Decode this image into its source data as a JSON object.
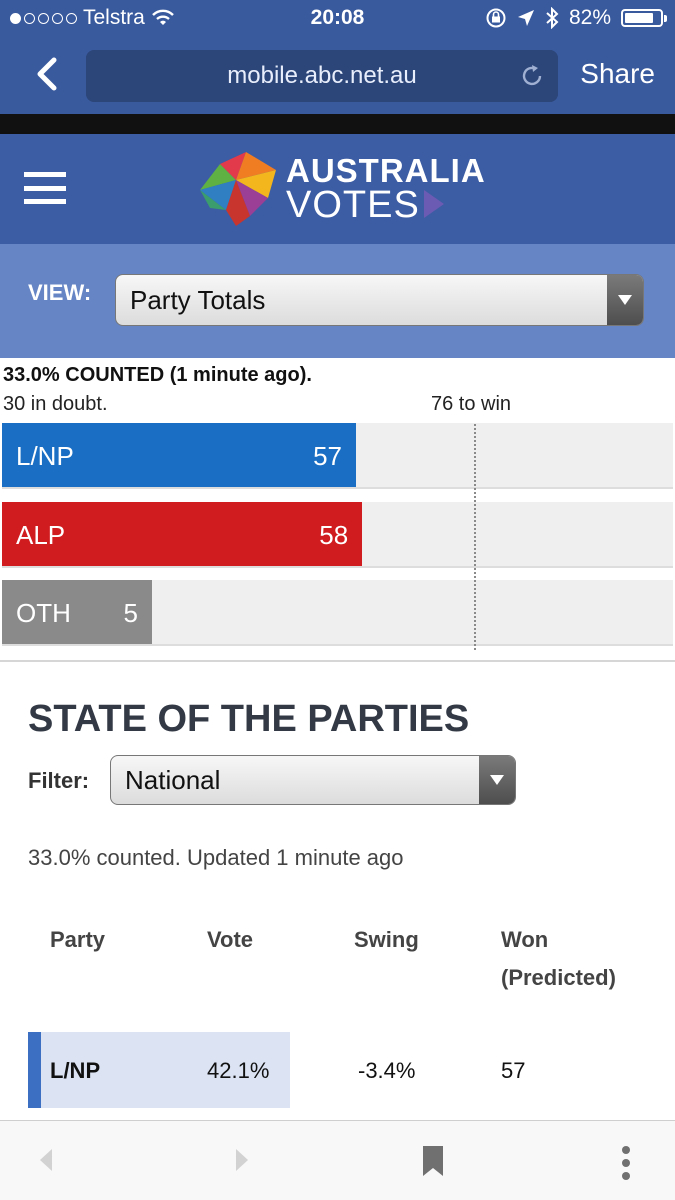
{
  "status_bar": {
    "carrier": "Telstra",
    "time": "20:08",
    "battery": "82%",
    "battery_level": 0.82
  },
  "browser": {
    "url": "mobile.abc.net.au",
    "share_label": "Share"
  },
  "site": {
    "logo_line1": "AUSTRALIA",
    "logo_line2": "VOTES"
  },
  "view": {
    "label": "VIEW:",
    "selected": "Party Totals"
  },
  "summary": {
    "counted": "33.0% COUNTED (1 minute ago).",
    "in_doubt": "30 in doubt.",
    "to_win": "76 to win"
  },
  "seat_bars": [
    {
      "party": "L/NP",
      "seats": "57",
      "seats_value": 57,
      "color": "#1a6fc4"
    },
    {
      "party": "ALP",
      "seats": "58",
      "seats_value": 58,
      "color": "#d01b1f"
    },
    {
      "party": "OTH",
      "seats": "5",
      "seats_value": 5,
      "color": "#8a8a8a"
    }
  ],
  "state_of_parties": {
    "title": "STATE OF THE PARTIES",
    "filter_label": "Filter:",
    "filter_selected": "National",
    "updated": "33.0% counted. Updated 1 minute ago",
    "columns": {
      "party": "Party",
      "vote": "Vote",
      "swing": "Swing",
      "won_line1": "Won",
      "won_line2": "(Predicted)"
    },
    "rows": [
      {
        "party": "L/NP",
        "vote": "42.1%",
        "swing": "-3.4%",
        "won": "57"
      }
    ]
  },
  "colors": {
    "browser_chrome": "#3a5a9e",
    "header": "#3c5ca3",
    "view_panel": "#6585c4",
    "lnp": "#1a6fc4",
    "alp": "#d01b1f",
    "oth": "#8a8a8a"
  },
  "icons": [
    "wifi-icon",
    "lock-rotation-icon",
    "location-arrow-icon",
    "bluetooth-icon",
    "battery-icon",
    "back-chevron-icon",
    "reload-icon",
    "hamburger-menu-icon",
    "australia-votes-logo",
    "dropdown-arrow-icon",
    "forward-arrow-icon",
    "bookmark-icon",
    "more-icon"
  ]
}
